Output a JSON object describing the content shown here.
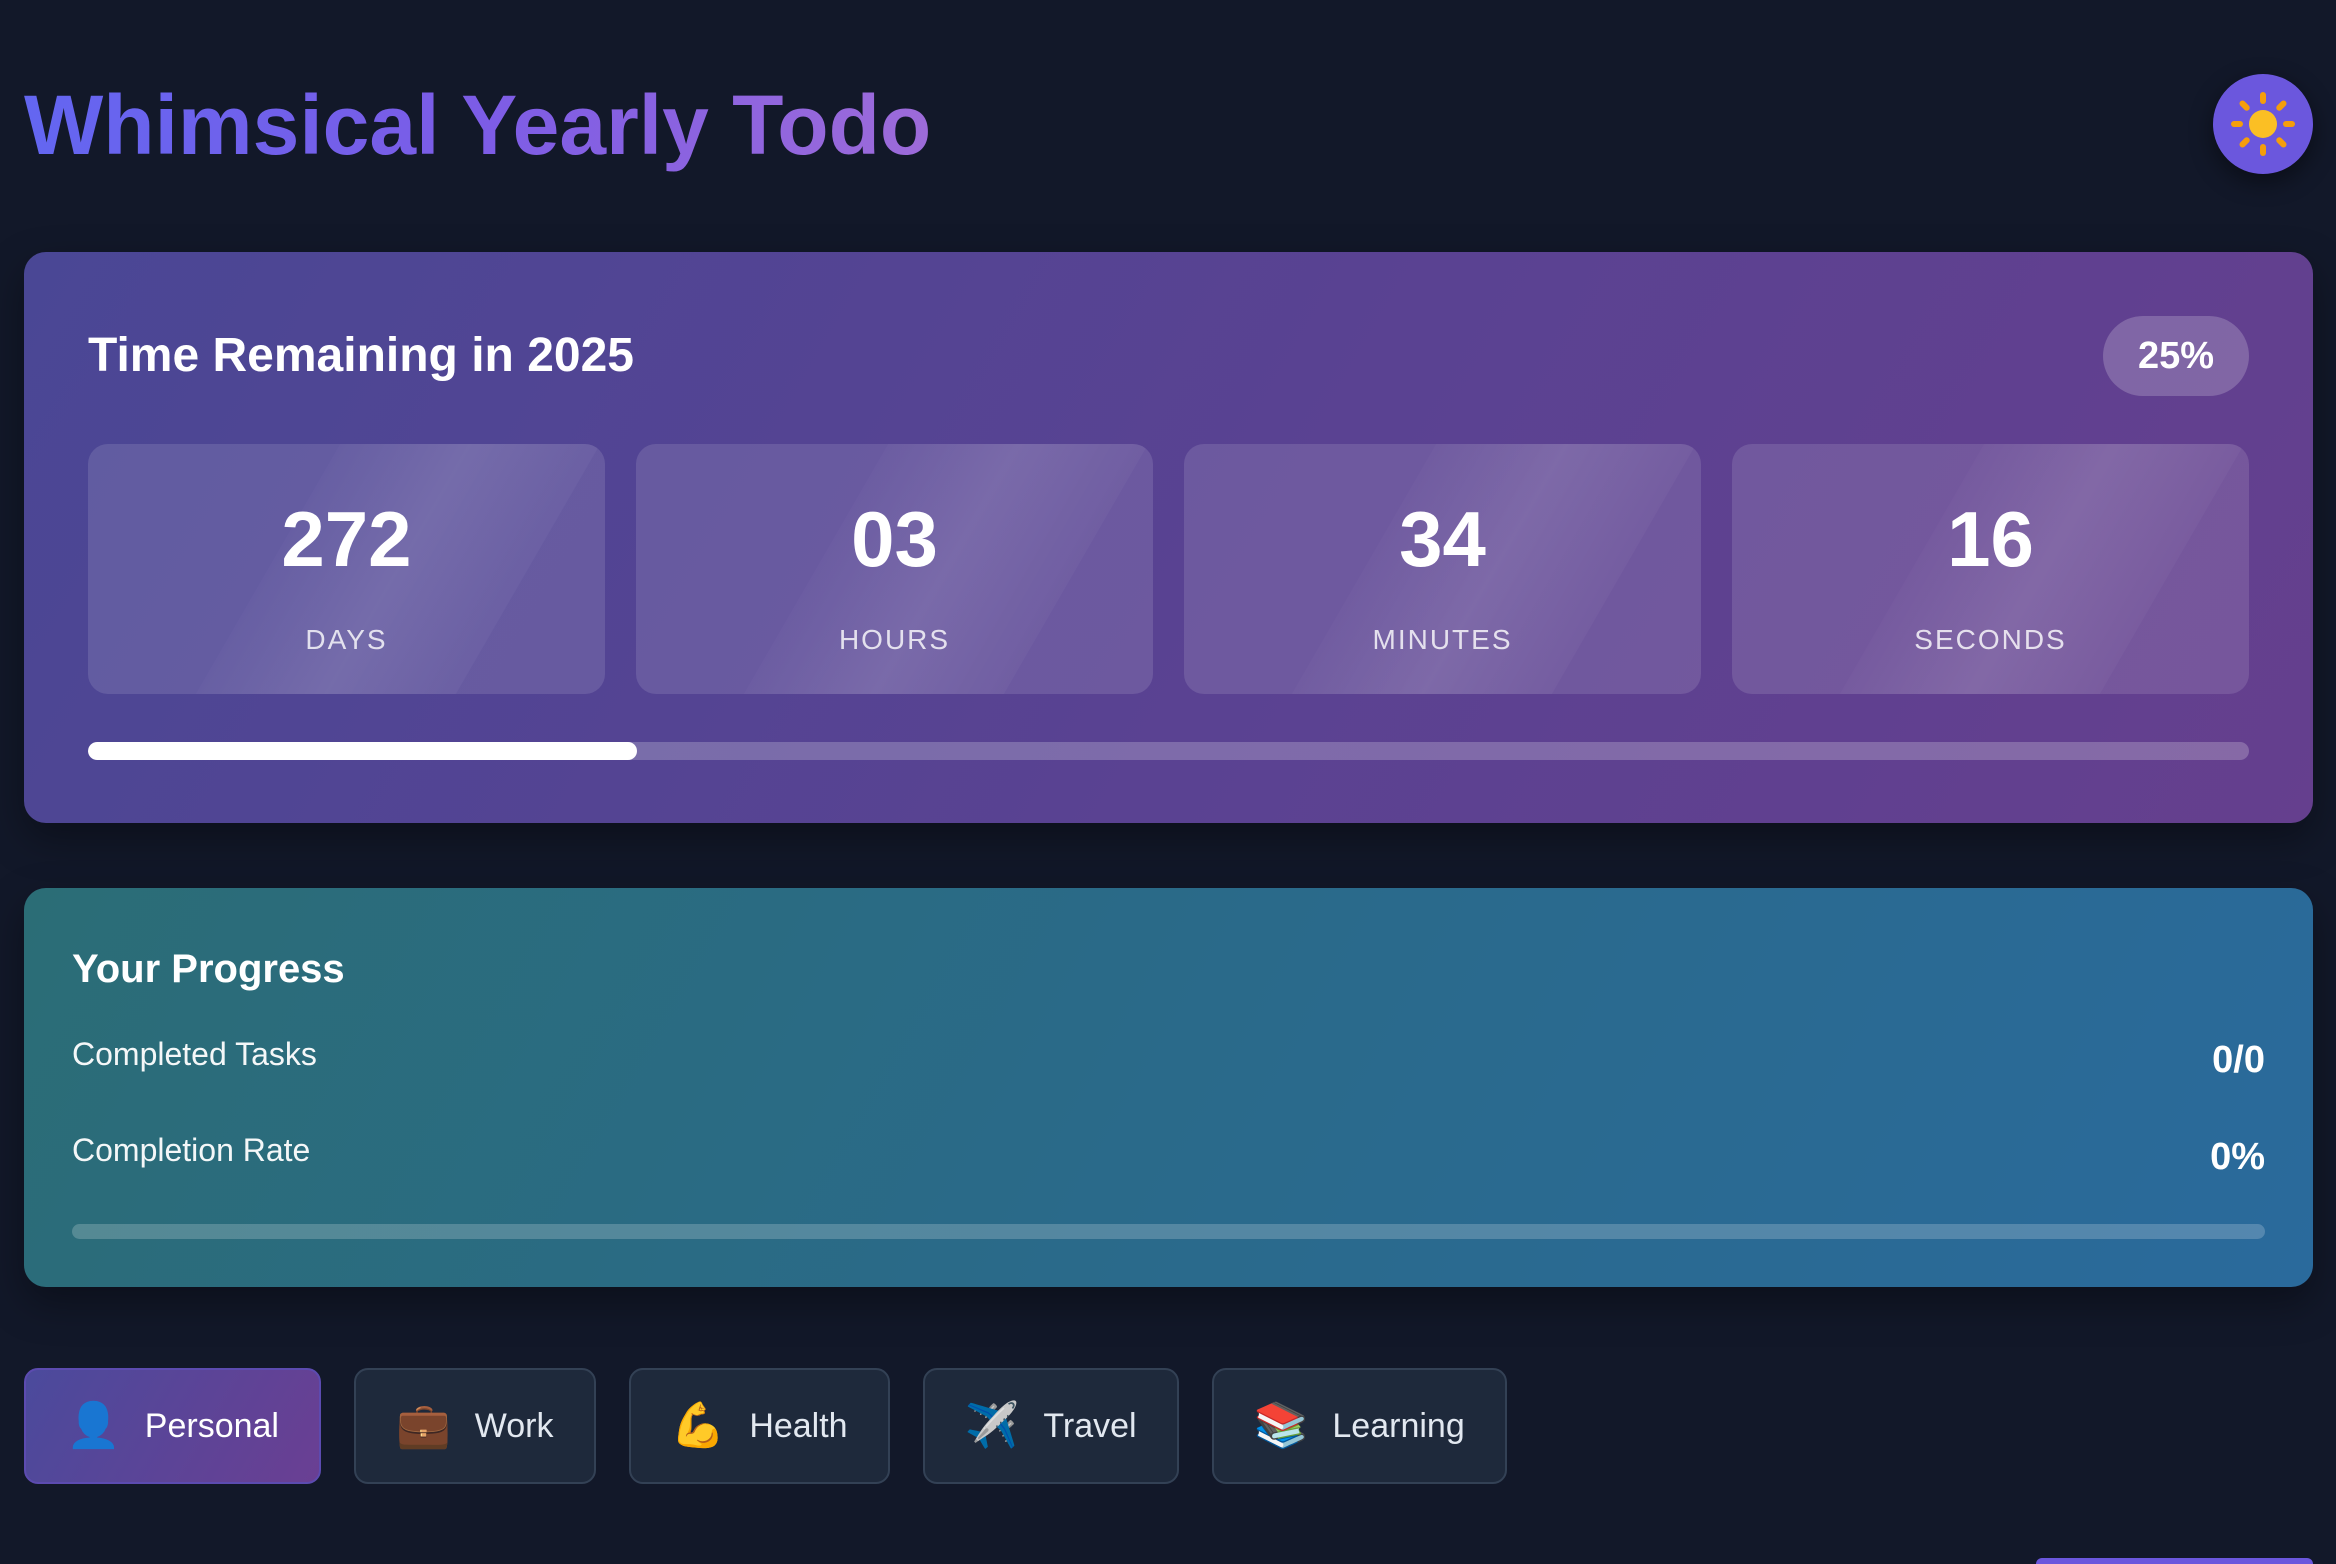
{
  "header": {
    "title": "Whimsical Yearly Todo",
    "theme_icon": "sun-icon"
  },
  "countdown": {
    "heading": "Time Remaining in 2025",
    "percent_label": "25%",
    "year_progress_fraction": 0.254,
    "units": [
      {
        "value": "272",
        "label": "DAYS"
      },
      {
        "value": "03",
        "label": "HOURS"
      },
      {
        "value": "34",
        "label": "MINUTES"
      },
      {
        "value": "16",
        "label": "SECONDS"
      }
    ]
  },
  "progress": {
    "heading": "Your Progress",
    "stats": [
      {
        "label": "Completed Tasks",
        "value": "0/0"
      },
      {
        "label": "Completion Rate",
        "value": "0%"
      }
    ],
    "completion_fraction": 0
  },
  "categories": [
    {
      "icon": "👤",
      "icon_name": "person-icon",
      "label": "Personal",
      "active": true
    },
    {
      "icon": "💼",
      "icon_name": "briefcase-icon",
      "label": "Work",
      "active": false
    },
    {
      "icon": "💪",
      "icon_name": "flexed-biceps-icon",
      "label": "Health",
      "active": false
    },
    {
      "icon": "✈️",
      "icon_name": "airplane-icon",
      "label": "Travel",
      "active": false
    },
    {
      "icon": "📚",
      "icon_name": "books-icon",
      "label": "Learning",
      "active": false
    }
  ],
  "colors": {
    "background": "#121829",
    "accent": "#6b57dd",
    "countdown_gradient": [
      "#4a4795",
      "#653f8e"
    ],
    "progress_gradient": [
      "#2b6d76",
      "#2a6a9c"
    ]
  }
}
